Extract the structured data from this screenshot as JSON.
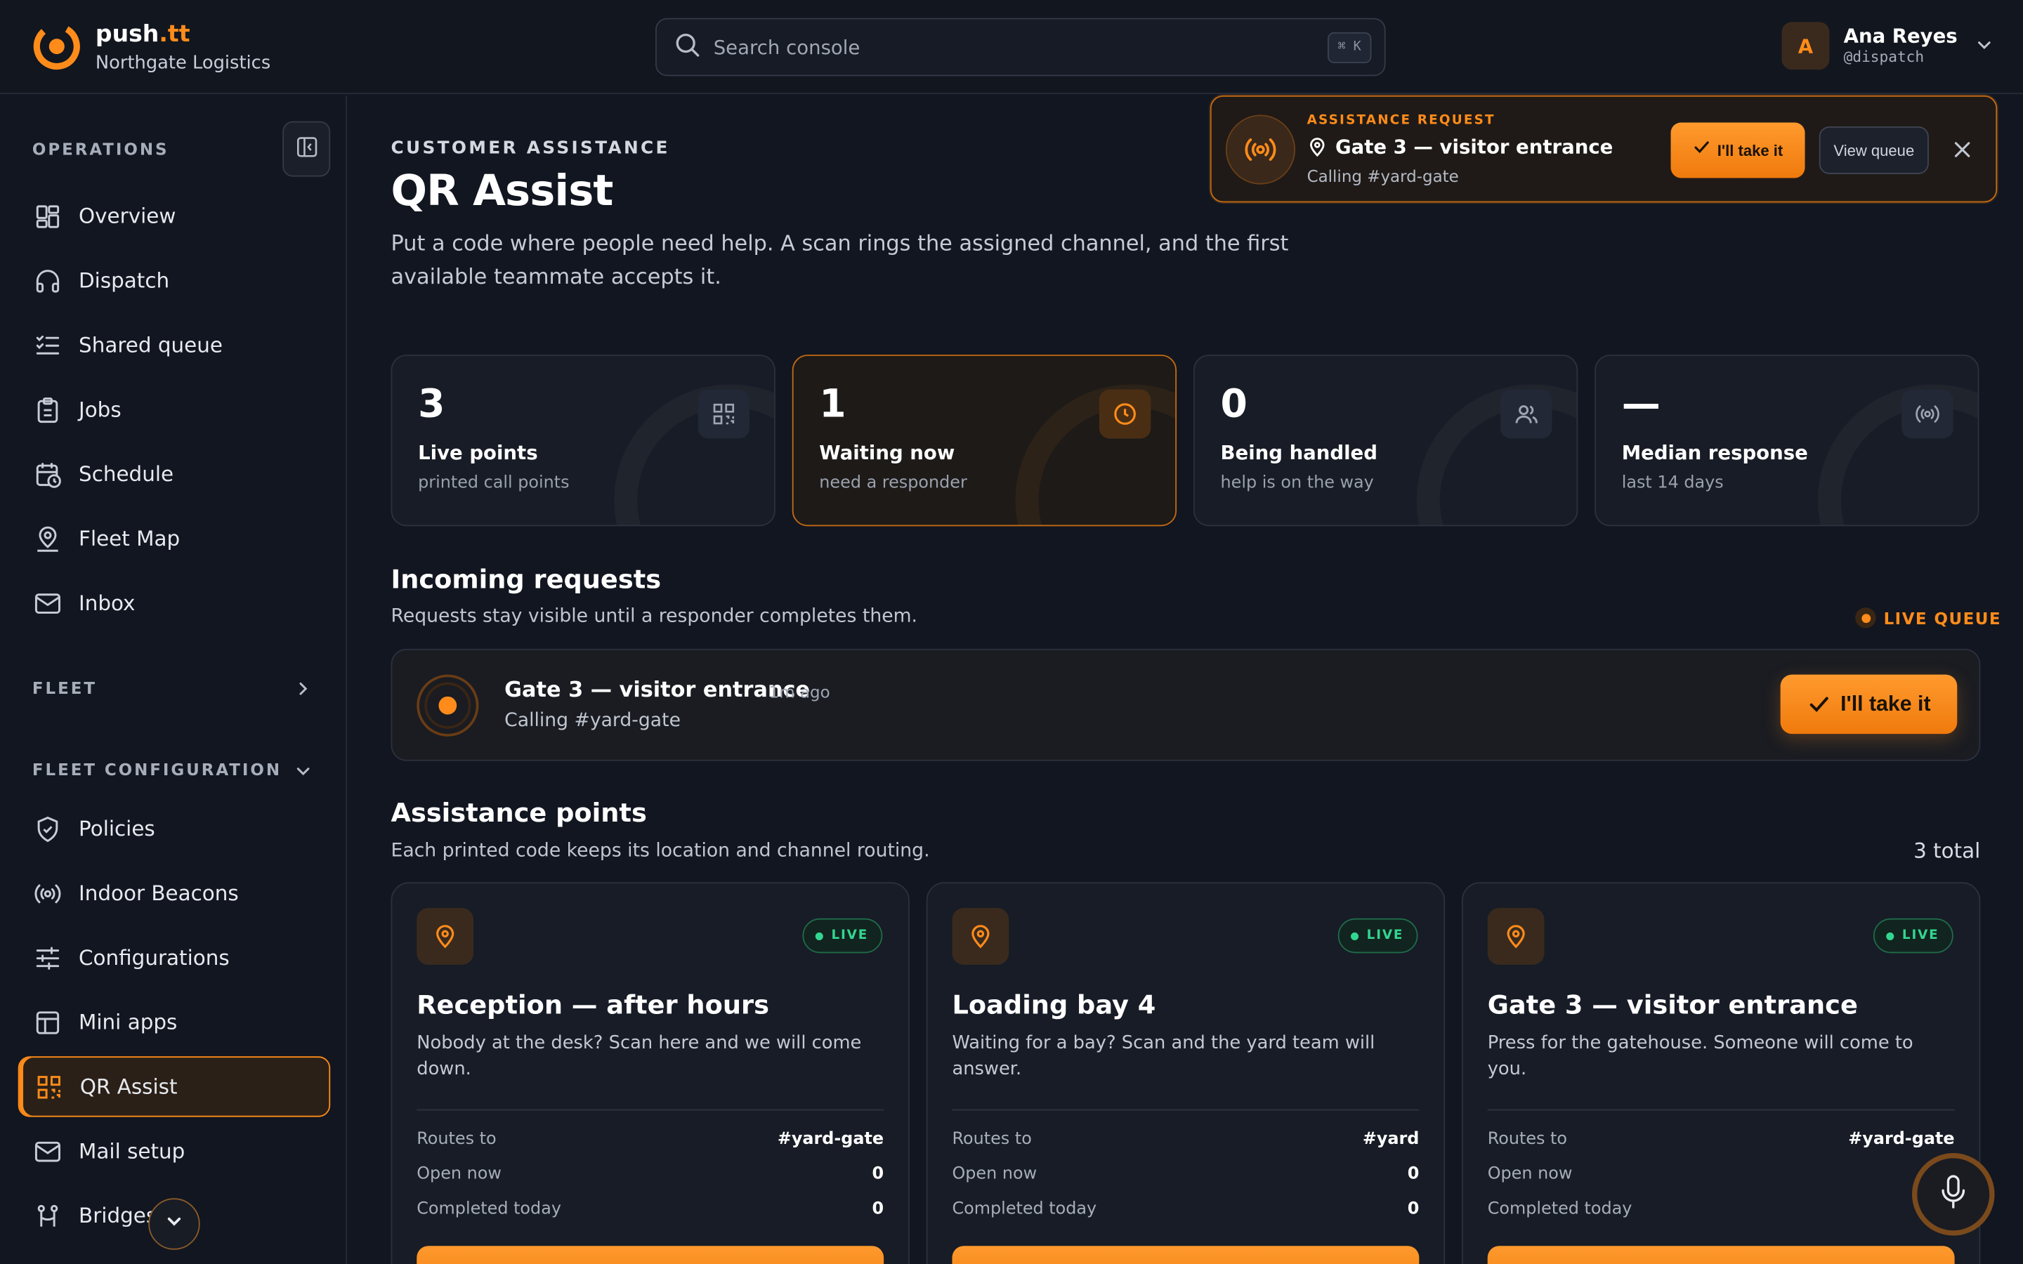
{
  "brand": {
    "name_main": "push",
    "name_accent": ".tt",
    "org": "Northgate Logistics"
  },
  "search": {
    "placeholder": "Search console",
    "shortcut": "⌘ K"
  },
  "user": {
    "initial": "A",
    "name": "Ana Reyes",
    "handle": "@dispatch"
  },
  "sidebar": {
    "operations_title": "OPERATIONS",
    "operations": [
      {
        "label": "Overview",
        "icon": "grid-icon"
      },
      {
        "label": "Dispatch",
        "icon": "headset-icon"
      },
      {
        "label": "Shared queue",
        "icon": "checklist-icon"
      },
      {
        "label": "Jobs",
        "icon": "clipboard-icon"
      },
      {
        "label": "Schedule",
        "icon": "calendar-clock-icon"
      },
      {
        "label": "Fleet Map",
        "icon": "map-pin-user-icon"
      },
      {
        "label": "Inbox",
        "icon": "mail-icon"
      }
    ],
    "fleet_title": "FLEET",
    "fleet_config_title": "FLEET CONFIGURATION",
    "config": [
      {
        "label": "Policies",
        "icon": "shield-check-icon"
      },
      {
        "label": "Indoor Beacons",
        "icon": "broadcast-icon"
      },
      {
        "label": "Configurations",
        "icon": "sliders-icon"
      },
      {
        "label": "Mini apps",
        "icon": "layout-icon"
      },
      {
        "label": "QR Assist",
        "icon": "qr-code-icon",
        "active": true
      },
      {
        "label": "Mail setup",
        "icon": "mail-icon"
      },
      {
        "label": "Bridges",
        "icon": "bridge-icon"
      }
    ]
  },
  "page": {
    "eyebrow": "CUSTOMER ASSISTANCE",
    "title": "QR Assist",
    "description": "Put a code where people need help. A scan rings the assigned channel, and the first available teammate accepts it."
  },
  "notification": {
    "eyebrow": "ASSISTANCE REQUEST",
    "title": "Gate 3 — visitor entrance",
    "subtitle": "Calling #yard-gate",
    "accept_label": "I'll take it",
    "view_label": "View queue"
  },
  "stats": [
    {
      "value": "3",
      "label": "Live points",
      "sub": "printed call points",
      "icon": "qr-code-icon",
      "highlight": false
    },
    {
      "value": "1",
      "label": "Waiting now",
      "sub": "need a responder",
      "icon": "clock-icon",
      "highlight": true
    },
    {
      "value": "0",
      "label": "Being handled",
      "sub": "help is on the way",
      "icon": "users-icon",
      "highlight": false
    },
    {
      "value": "—",
      "label": "Median response",
      "sub": "last 14 days",
      "icon": "broadcast-icon",
      "highlight": false
    }
  ],
  "incoming": {
    "title": "Incoming requests",
    "subtitle": "Requests stay visible until a responder completes them.",
    "badge": "LIVE QUEUE",
    "requests": [
      {
        "title": "Gate 3 — visitor entrance",
        "age": "1m ago",
        "subtitle": "Calling #yard-gate",
        "action": "I'll take it"
      }
    ]
  },
  "points": {
    "title": "Assistance points",
    "subtitle": "Each printed code keeps its location and channel routing.",
    "total": "3 total",
    "row_labels": {
      "routes": "Routes to",
      "open": "Open now",
      "completed": "Completed today"
    },
    "items": [
      {
        "status": "LIVE",
        "title": "Reception — after hours",
        "description": "Nobody at the desk? Scan here and we will come down.",
        "routes_to": "#yard-gate",
        "open_now": "0",
        "completed_today": "0"
      },
      {
        "status": "LIVE",
        "title": "Loading bay 4",
        "description": "Waiting for a bay? Scan and the yard team will answer.",
        "routes_to": "#yard",
        "open_now": "0",
        "completed_today": "0"
      },
      {
        "status": "LIVE",
        "title": "Gate 3 — visitor entrance",
        "description": "Press for the gatehouse. Someone will come to you.",
        "routes_to": "#yard-gate",
        "open_now": "",
        "completed_today": ""
      }
    ]
  },
  "colors": {
    "accent": "#ff8c1a",
    "live": "#33d690",
    "background": "#121620"
  }
}
